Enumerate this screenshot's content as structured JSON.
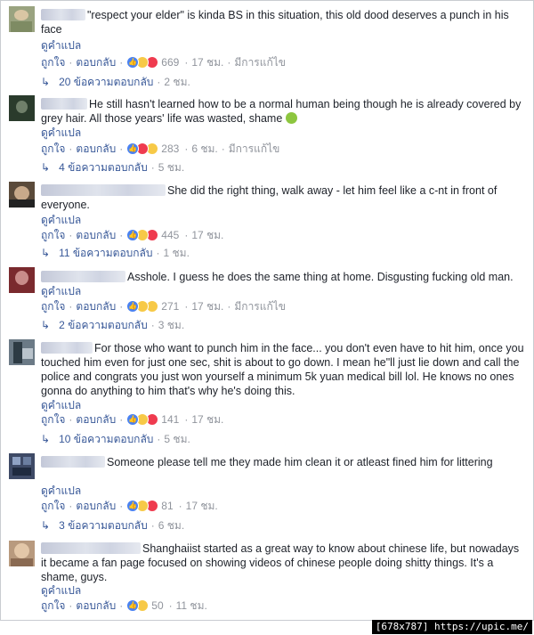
{
  "comments": [
    {
      "text": "\"respect your elder\" is kinda BS in this situation, this old dood deserves a punch in his face",
      "translate": "ดูคำแปล",
      "like": "ถูกใจ",
      "reply": "ตอบกลับ",
      "count": "669",
      "time": "17 ชม.",
      "edited": "มีการแก้ไข",
      "reactions": [
        "like-icon",
        "haha-icon",
        "love-icon"
      ],
      "replies": "20 ข้อความตอบกลับ",
      "reply_time": "2 ชม."
    },
    {
      "text": "He still hasn't learned how to be a normal human being though he is already covered by grey hair. All those years' life was wasted, shame",
      "translate": "ดูคำแปล",
      "like": "ถูกใจ",
      "reply": "ตอบกลับ",
      "count": "283",
      "time": "6 ชม.",
      "edited": "มีการแก้ไข",
      "reactions": [
        "like-icon",
        "love-icon",
        "haha-icon"
      ],
      "replies": "4 ข้อความตอบกลับ",
      "reply_time": "5 ชม."
    },
    {
      "text": "She did the right thing, walk away - let him feel like a c-nt in front of everyone.",
      "translate": "ดูคำแปล",
      "like": "ถูกใจ",
      "reply": "ตอบกลับ",
      "count": "445",
      "time": "17 ชม.",
      "edited": "",
      "reactions": [
        "like-icon",
        "haha-icon",
        "love-icon"
      ],
      "replies": "11 ข้อความตอบกลับ",
      "reply_time": "1 ชม."
    },
    {
      "text": "Asshole. I guess he does the same thing at home. Disgusting fucking old man.",
      "translate": "ดูคำแปล",
      "like": "ถูกใจ",
      "reply": "ตอบกลับ",
      "count": "271",
      "time": "17 ชม.",
      "edited": "มีการแก้ไข",
      "reactions": [
        "like-icon",
        "haha-icon",
        "wow-icon"
      ],
      "replies": "2 ข้อความตอบกลับ",
      "reply_time": "3 ชม."
    },
    {
      "text": "For those who want to punch him in the face... you don't even have to hit him, once you touched him even for just one sec, shit is about to go down. I mean he\"ll just lie down and call the police and congrats you just won yourself a minimum 5k yuan medical bill lol. He knows no ones gonna do anything to him that's why he's doing this.",
      "translate": "ดูคำแปล",
      "like": "ถูกใจ",
      "reply": "ตอบกลับ",
      "count": "141",
      "time": "17 ชม.",
      "edited": "",
      "reactions": [
        "like-icon",
        "haha-icon",
        "love-icon"
      ],
      "replies": "10 ข้อความตอบกลับ",
      "reply_time": "5 ชม."
    },
    {
      "text": "Someone please tell me they made him clean it or atleast fined him for littering",
      "translate": "ดูคำแปล",
      "like": "ถูกใจ",
      "reply": "ตอบกลับ",
      "count": "81",
      "time": "17 ชม.",
      "edited": "",
      "reactions": [
        "like-icon",
        "haha-icon",
        "love-icon"
      ],
      "replies": "3 ข้อความตอบกลับ",
      "reply_time": "6 ชม."
    },
    {
      "text": "Shanghaiist started as a great way to know about chinese life, but nowadays it became a fan page focused on showing videos of chinese people doing shitty things. It's a shame, guys.",
      "translate": "ดูคำแปล",
      "like": "ถูกใจ",
      "reply": "ตอบกลับ",
      "count": "50",
      "time": "11 ชม.",
      "edited": "",
      "reactions": [
        "like-icon",
        "haha-icon"
      ],
      "replies": "",
      "reply_time": ""
    }
  ],
  "caption": "[678x787] https://upic.me/",
  "colors": {
    "link": "#385898",
    "meta": "#90949c",
    "text": "#1d2129",
    "like": "#4a82f2",
    "haha": "#f7c947",
    "love": "#ef3b4f"
  }
}
